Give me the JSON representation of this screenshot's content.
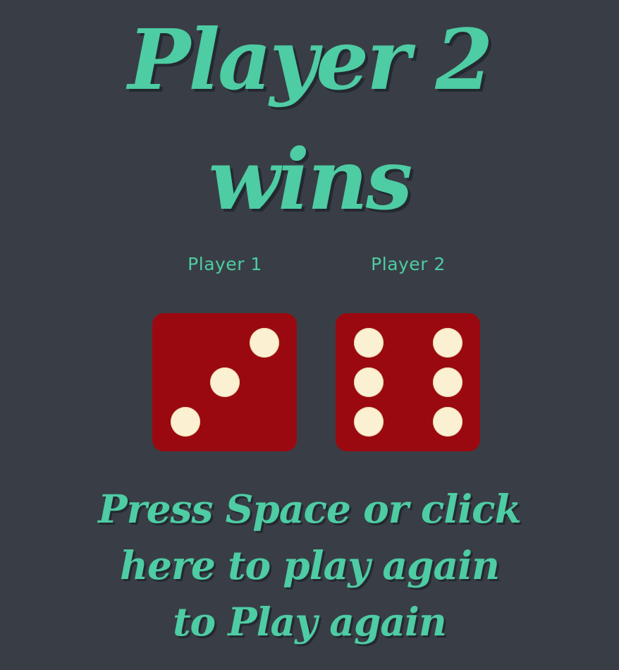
{
  "result": {
    "title_line1": "Player 2",
    "title_line2": "wins"
  },
  "players": [
    {
      "label": "Player 1",
      "die_value": 3
    },
    {
      "label": "Player 2",
      "die_value": 6
    }
  ],
  "prompt": "Press Space or click here to play again to Play again",
  "colors": {
    "background": "#393E46",
    "accent": "#4ECCA3",
    "die": "#9B0910",
    "pip": "#FBF0D1"
  }
}
